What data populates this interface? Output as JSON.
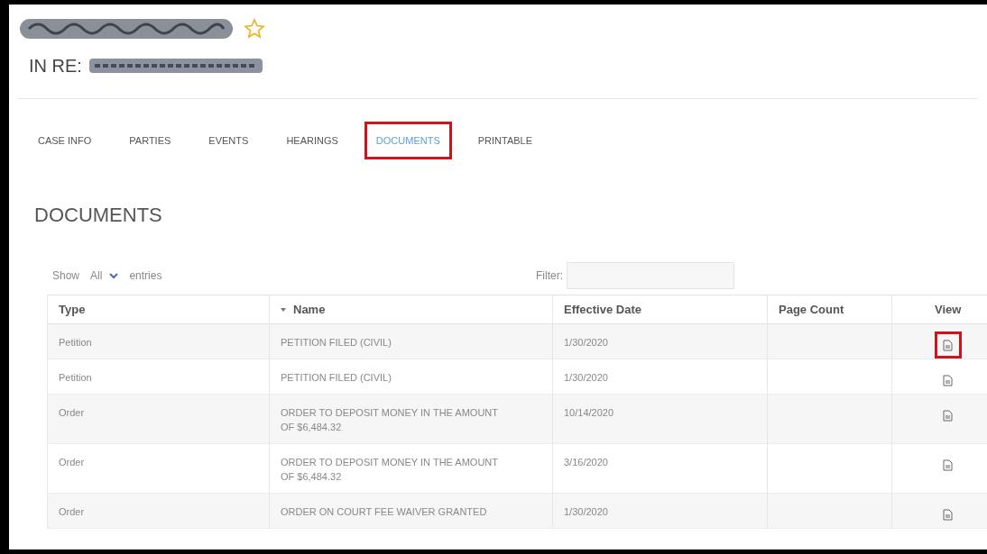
{
  "header": {
    "starred": false,
    "in_re_label": "IN RE:"
  },
  "tabs": [
    {
      "label": "CASE INFO",
      "selected": false,
      "annotated": false
    },
    {
      "label": "PARTIES",
      "selected": false,
      "annotated": false
    },
    {
      "label": "EVENTS",
      "selected": false,
      "annotated": false
    },
    {
      "label": "HEARINGS",
      "selected": false,
      "annotated": false
    },
    {
      "label": "DOCUMENTS",
      "selected": true,
      "annotated": true
    },
    {
      "label": "PRINTABLE",
      "selected": false,
      "annotated": false
    }
  ],
  "section_title": "DOCUMENTS",
  "length_control": {
    "before": "Show",
    "value": "All",
    "after": "entries"
  },
  "filter": {
    "label": "Filter:"
  },
  "table": {
    "columns": [
      {
        "label": "Type",
        "sorted": false
      },
      {
        "label": "Name",
        "sorted": true
      },
      {
        "label": "Effective Date",
        "sorted": false
      },
      {
        "label": "Page Count",
        "sorted": false
      },
      {
        "label": "View",
        "sorted": false
      }
    ],
    "rows": [
      {
        "type": "Petition",
        "name": "PETITION FILED (CIVIL)",
        "effective_date": "1/30/2020",
        "view_annotated": true
      },
      {
        "type": "Petition",
        "name": "PETITION FILED (CIVIL)",
        "effective_date": "1/30/2020",
        "view_annotated": false
      },
      {
        "type": "Order",
        "name": "ORDER TO DEPOSIT MONEY IN THE AMOUNT OF $6,484.32",
        "effective_date": "10/14/2020",
        "view_annotated": false
      },
      {
        "type": "Order",
        "name": "ORDER TO DEPOSIT MONEY IN THE AMOUNT OF $6,484.32",
        "effective_date": "3/16/2020",
        "view_annotated": false
      },
      {
        "type": "Order",
        "name": "ORDER ON COURT FEE WAIVER GRANTED",
        "effective_date": "1/30/2020",
        "view_annotated": false
      }
    ]
  }
}
